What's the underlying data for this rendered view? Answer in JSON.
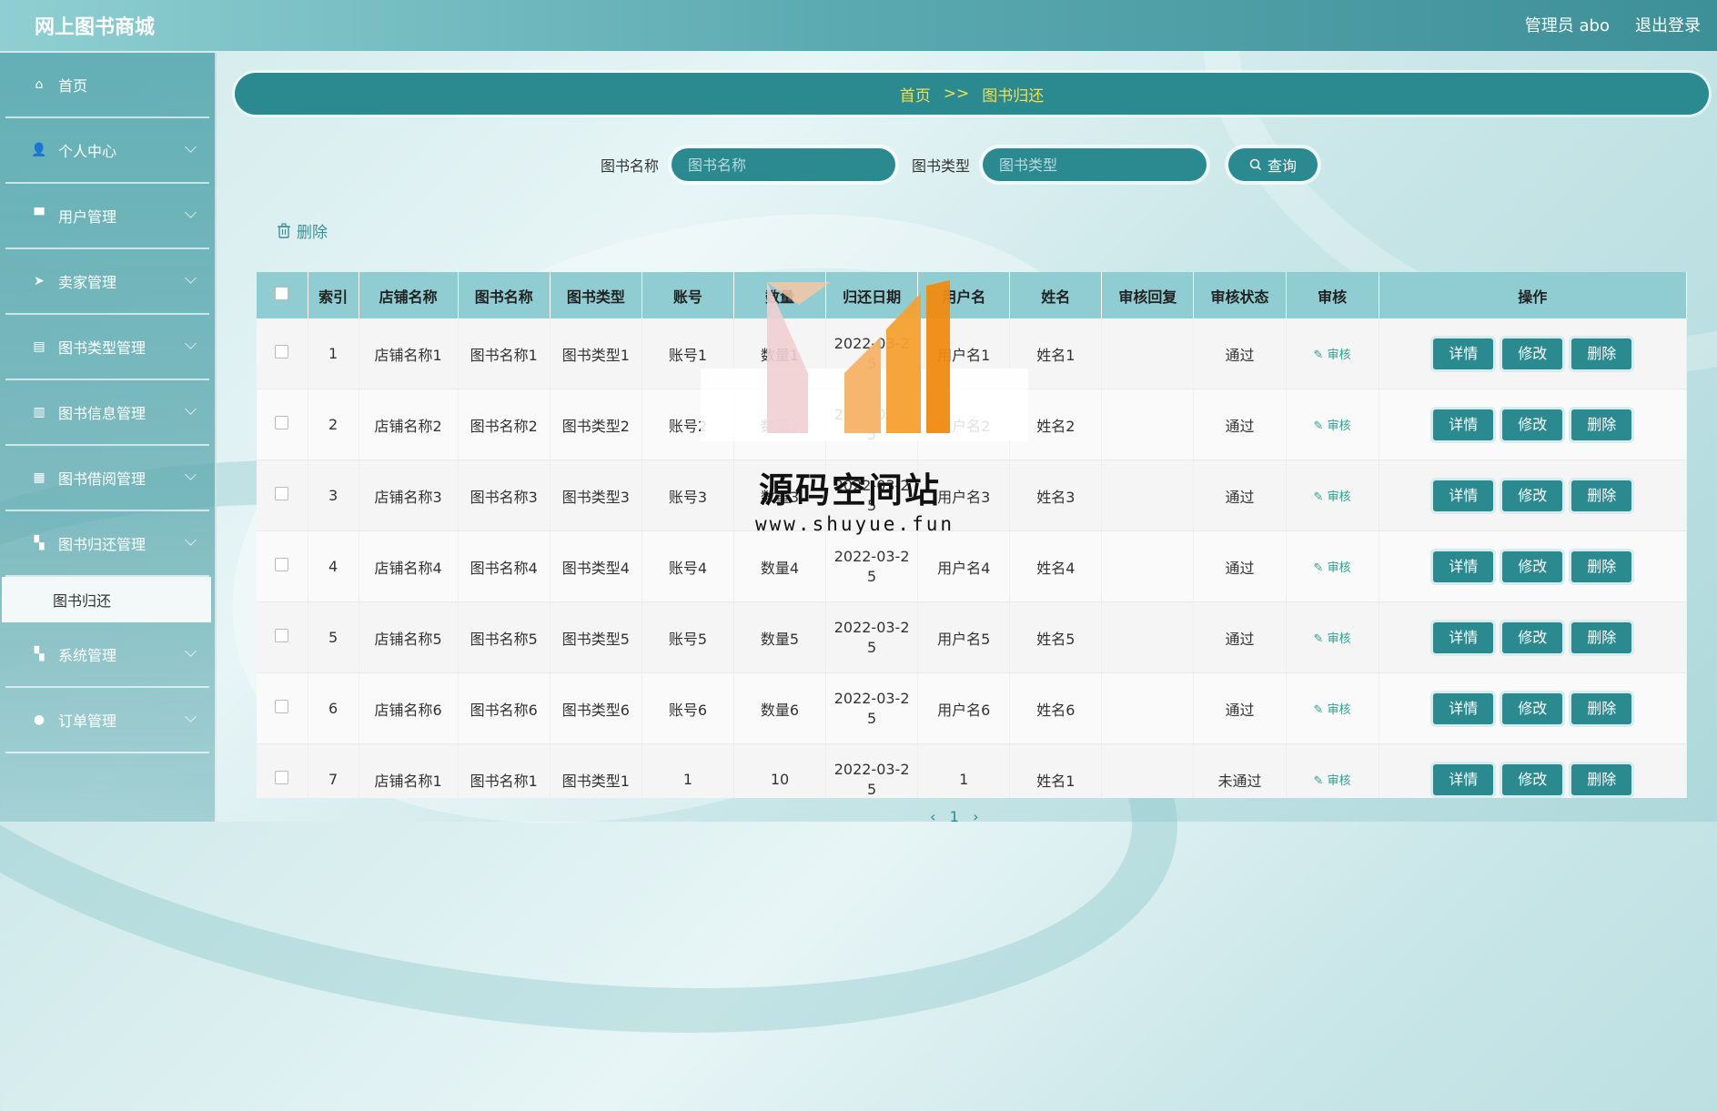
{
  "app": {
    "title": "网上图书商城"
  },
  "header": {
    "user_label": "管理员 abo",
    "logout_label": "退出登录"
  },
  "sidebar": {
    "items": [
      {
        "label": "首页",
        "icon": "home-icon",
        "glyph": "⌂"
      },
      {
        "label": "个人中心",
        "icon": "user-icon",
        "glyph": "👤"
      },
      {
        "label": "用户管理",
        "icon": "monitor-icon",
        "glyph": "▀"
      },
      {
        "label": "卖家管理",
        "icon": "send-icon",
        "glyph": "➤"
      },
      {
        "label": "图书类型管理",
        "icon": "clipboard-icon",
        "glyph": "▤"
      },
      {
        "label": "图书信息管理",
        "icon": "chart-icon",
        "glyph": "▥"
      },
      {
        "label": "图书借阅管理",
        "icon": "grid-icon",
        "glyph": "▦"
      },
      {
        "label": "图书归还管理",
        "icon": "apps-icon",
        "glyph": "▚"
      }
    ],
    "active_sub": "图书归还",
    "items_after": [
      {
        "label": "系统管理",
        "icon": "apps-icon",
        "glyph": "▚"
      },
      {
        "label": "订单管理",
        "icon": "bulb-icon",
        "glyph": "●"
      }
    ]
  },
  "breadcrumb": {
    "home": "首页",
    "separator": ">>",
    "current": "图书归还"
  },
  "search": {
    "name_label": "图书名称",
    "name_placeholder": "图书名称",
    "type_label": "图书类型",
    "type_placeholder": "图书类型",
    "query_label": "查询"
  },
  "actions": {
    "delete_label": "删除"
  },
  "table": {
    "headers": [
      "",
      "索引",
      "店铺名称",
      "图书名称",
      "图书类型",
      "账号",
      "数量",
      "归还日期",
      "用户名",
      "姓名",
      "审核回复",
      "审核状态",
      "审核",
      "操作"
    ],
    "rows": [
      {
        "index": "1",
        "shop": "店铺名称1",
        "book": "图书名称1",
        "type": "图书类型1",
        "account": "账号1",
        "qty": "数量1",
        "date": "2022-03-25",
        "username": "用户名1",
        "name": "姓名1",
        "reply": "",
        "status": "通过"
      },
      {
        "index": "2",
        "shop": "店铺名称2",
        "book": "图书名称2",
        "type": "图书类型2",
        "account": "账号2",
        "qty": "数量2",
        "date": "2022-03-25",
        "username": "用户名2",
        "name": "姓名2",
        "reply": "",
        "status": "通过"
      },
      {
        "index": "3",
        "shop": "店铺名称3",
        "book": "图书名称3",
        "type": "图书类型3",
        "account": "账号3",
        "qty": "数量3",
        "date": "2022-03-25",
        "username": "用户名3",
        "name": "姓名3",
        "reply": "",
        "status": "通过"
      },
      {
        "index": "4",
        "shop": "店铺名称4",
        "book": "图书名称4",
        "type": "图书类型4",
        "account": "账号4",
        "qty": "数量4",
        "date": "2022-03-25",
        "username": "用户名4",
        "name": "姓名4",
        "reply": "",
        "status": "通过"
      },
      {
        "index": "5",
        "shop": "店铺名称5",
        "book": "图书名称5",
        "type": "图书类型5",
        "account": "账号5",
        "qty": "数量5",
        "date": "2022-03-25",
        "username": "用户名5",
        "name": "姓名5",
        "reply": "",
        "status": "通过"
      },
      {
        "index": "6",
        "shop": "店铺名称6",
        "book": "图书名称6",
        "type": "图书类型6",
        "account": "账号6",
        "qty": "数量6",
        "date": "2022-03-25",
        "username": "用户名6",
        "name": "姓名6",
        "reply": "",
        "status": "通过"
      },
      {
        "index": "7",
        "shop": "店铺名称1",
        "book": "图书名称1",
        "type": "图书类型1",
        "account": "1",
        "qty": "10",
        "date": "2022-03-25",
        "username": "1",
        "name": "姓名1",
        "reply": "",
        "status": "未通过"
      }
    ],
    "audit_label": "审核",
    "op_labels": {
      "detail": "详情",
      "edit": "修改",
      "delete": "删除"
    }
  },
  "pager": {
    "current": "1"
  },
  "watermark": {
    "title": "源码空间站",
    "url": "www.shuyue.fun"
  },
  "colors": {
    "primary": "#2a8a90",
    "header_bg": "#8fcdd2",
    "crumb_text": "#f4e04d",
    "audit": "#2aa38f"
  }
}
